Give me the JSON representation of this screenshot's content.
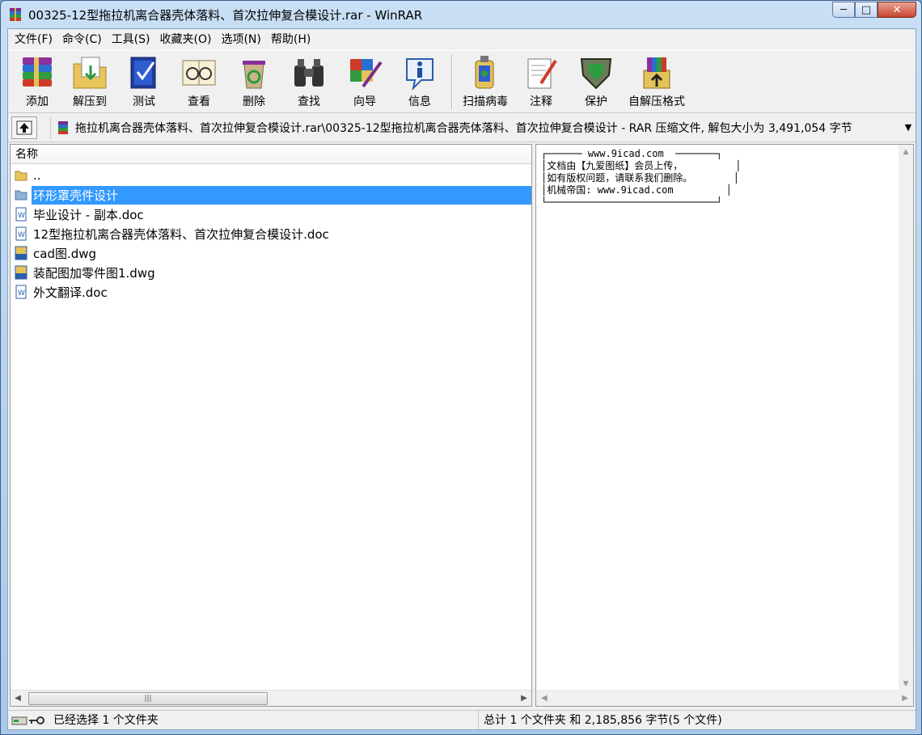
{
  "window": {
    "title": "00325-12型拖拉机离合器壳体落料、首次拉伸复合模设计.rar - WinRAR",
    "min_glyph": "─",
    "max_glyph": "□",
    "close_glyph": "✕"
  },
  "menu": [
    "文件(F)",
    "命令(C)",
    "工具(S)",
    "收藏夹(O)",
    "选项(N)",
    "帮助(H)"
  ],
  "toolbar": [
    {
      "label": "添加",
      "icon": "books-stack-icon"
    },
    {
      "label": "解压到",
      "icon": "folder-extract-icon"
    },
    {
      "label": "测试",
      "icon": "checkbook-icon"
    },
    {
      "label": "查看",
      "icon": "glasses-book-icon"
    },
    {
      "label": "删除",
      "icon": "recycle-bin-icon"
    },
    {
      "label": "查找",
      "icon": "binoculars-icon"
    },
    {
      "label": "向导",
      "icon": "wizard-wand-icon"
    },
    {
      "label": "信息",
      "icon": "info-icon"
    },
    {
      "label": "扫描病毒",
      "icon": "virus-scan-icon"
    },
    {
      "label": "注释",
      "icon": "comment-pen-icon"
    },
    {
      "label": "保护",
      "icon": "shield-icon"
    },
    {
      "label": "自解压格式",
      "icon": "sfx-box-icon"
    }
  ],
  "address": {
    "path": "拖拉机离合器壳体落料、首次拉伸复合模设计.rar\\00325-12型拖拉机离合器壳体落料、首次拉伸复合模设计 - RAR 压缩文件, 解包大小为 3,491,054 字节",
    "dropdown_glyph": "▼"
  },
  "file_list": {
    "column_name": "名称",
    "rows": [
      {
        "name": "..",
        "type": "folder-up"
      },
      {
        "name": "环形罩壳件设计",
        "type": "folder",
        "selected": true
      },
      {
        "name": "毕业设计 - 副本.doc",
        "type": "doc"
      },
      {
        "name": "12型拖拉机离合器壳体落料、首次拉伸复合模设计.doc",
        "type": "doc"
      },
      {
        "name": "cad图.dwg",
        "type": "dwg"
      },
      {
        "name": "装配图加零件图1.dwg",
        "type": "dwg"
      },
      {
        "name": "外文翻译.doc",
        "type": "doc"
      }
    ],
    "scroll_thumb_glyph": "|||"
  },
  "comment": {
    "lines": [
      "┌────── www.9icad.com  ───────┐",
      "│文档由【九爱图纸】会员上传，         │",
      "│如有版权问题，请联系我们删除。       │",
      "│机械帝国: www.9icad.com         │",
      "└─────────────────────────────┘"
    ]
  },
  "status": {
    "left": "已经选择 1 个文件夹",
    "right": "总计 1 个文件夹 和 2,185,856 字节(5 个文件)"
  },
  "colors": {
    "selection": "#3399ff",
    "title_gradient_top": "#c9dff5",
    "close_button": "#c8452f"
  }
}
